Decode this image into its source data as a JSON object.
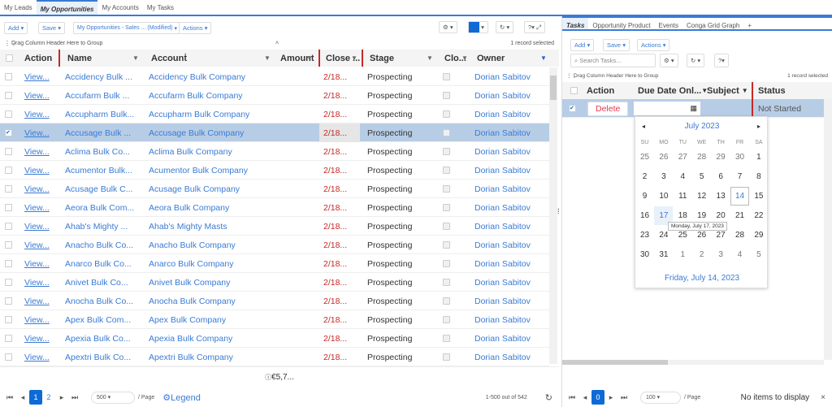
{
  "top_tabs": [
    {
      "label": "My Leads"
    },
    {
      "label": "My Opportunities",
      "active": true
    },
    {
      "label": "My Accounts"
    },
    {
      "label": "My Tasks"
    }
  ],
  "left": {
    "toolbar": {
      "add": "Add",
      "save": "Save",
      "view": "My Opportunities - Sales ... (Modified)",
      "actions": "Actions"
    },
    "group_hint": "Drag Column Header Here to Group",
    "selected_count": "1 record selected",
    "columns": [
      "Action",
      "Name",
      "Account",
      "Amount",
      "Close ...",
      "Stage",
      "Clo...",
      "Owner"
    ],
    "rows": [
      {
        "action": "View...",
        "name": "Accidency Bulk ...",
        "account": "Accidency Bulk Company",
        "close": "2/18...",
        "stage": "Prospecting",
        "owner": "Dorian Sabitov"
      },
      {
        "action": "View...",
        "name": "Accufarm Bulk ...",
        "account": "Accufarm Bulk Company",
        "close": "2/18...",
        "stage": "Prospecting",
        "owner": "Dorian Sabitov"
      },
      {
        "action": "View...",
        "name": "Accupharm Bulk...",
        "account": "Accupharm Bulk Company",
        "close": "2/18...",
        "stage": "Prospecting",
        "owner": "Dorian Sabitov"
      },
      {
        "action": "View...",
        "name": "Accusage Bulk ...",
        "account": "Accusage Bulk Company",
        "close": "2/18...",
        "stage": "Prospecting",
        "owner": "Dorian Sabitov",
        "selected": true
      },
      {
        "action": "View...",
        "name": "Aclima Bulk Co...",
        "account": "Aclima Bulk Company",
        "close": "2/18...",
        "stage": "Prospecting",
        "owner": "Dorian Sabitov"
      },
      {
        "action": "View...",
        "name": "Acumentor Bulk...",
        "account": "Acumentor Bulk Company",
        "close": "2/18...",
        "stage": "Prospecting",
        "owner": "Dorian Sabitov"
      },
      {
        "action": "View...",
        "name": "Acusage Bulk C...",
        "account": "Acusage Bulk Company",
        "close": "2/18...",
        "stage": "Prospecting",
        "owner": "Dorian Sabitov"
      },
      {
        "action": "View...",
        "name": "Aeora Bulk Com...",
        "account": "Aeora Bulk Company",
        "close": "2/18...",
        "stage": "Prospecting",
        "owner": "Dorian Sabitov"
      },
      {
        "action": "View...",
        "name": "Ahab's Mighty ...",
        "account": "Ahab's Mighty Masts",
        "close": "2/18...",
        "stage": "Prospecting",
        "owner": "Dorian Sabitov"
      },
      {
        "action": "View...",
        "name": "Anacho Bulk Co...",
        "account": "Anacho Bulk Company",
        "close": "2/18...",
        "stage": "Prospecting",
        "owner": "Dorian Sabitov"
      },
      {
        "action": "View...",
        "name": "Anarco Bulk Co...",
        "account": "Anarco Bulk Company",
        "close": "2/18...",
        "stage": "Prospecting",
        "owner": "Dorian Sabitov"
      },
      {
        "action": "View...",
        "name": "Anivet Bulk Co...",
        "account": "Anivet Bulk Company",
        "close": "2/18...",
        "stage": "Prospecting",
        "owner": "Dorian Sabitov"
      },
      {
        "action": "View...",
        "name": "Anocha Bulk Co...",
        "account": "Anocha Bulk Company",
        "close": "2/18...",
        "stage": "Prospecting",
        "owner": "Dorian Sabitov"
      },
      {
        "action": "View...",
        "name": "Apex Bulk Com...",
        "account": "Apex Bulk Company",
        "close": "2/18...",
        "stage": "Prospecting",
        "owner": "Dorian Sabitov"
      },
      {
        "action": "View...",
        "name": "Apexia Bulk Co...",
        "account": "Apexia Bulk Company",
        "close": "2/18...",
        "stage": "Prospecting",
        "owner": "Dorian Sabitov"
      },
      {
        "action": "View...",
        "name": "Apextri Bulk Co...",
        "account": "Apextri Bulk Company",
        "close": "2/18...",
        "stage": "Prospecting",
        "owner": "Dorian Sabitov"
      }
    ],
    "total": "€5,7...",
    "pager": {
      "pages": [
        "1",
        "2"
      ],
      "current": "1",
      "page_size": "500",
      "per_page": "/ Page",
      "legend": "Legend",
      "range": "1-500 out of 542"
    }
  },
  "right": {
    "tabs": [
      {
        "label": "Tasks",
        "active": true
      },
      {
        "label": "Opportunity Product"
      },
      {
        "label": "Events"
      },
      {
        "label": "Conga Grid Graph"
      },
      {
        "label": "+"
      }
    ],
    "toolbar": {
      "add": "Add",
      "save": "Save",
      "actions": "Actions",
      "search_placeholder": "Search Tasks..."
    },
    "group_hint": "Drag Column Header Here to Group",
    "selected_count": "1 record selected",
    "columns": [
      "Action",
      "Due Date Onl...",
      "Subject",
      "Status"
    ],
    "row": {
      "action": "Delete",
      "status": "Not Started"
    },
    "calendar": {
      "month": "July 2023",
      "weekdays": [
        "SU",
        "MO",
        "TU",
        "WE",
        "TH",
        "FR",
        "SA"
      ],
      "days": [
        [
          "25",
          "26",
          "27",
          "28",
          "29",
          "30",
          "1"
        ],
        [
          "2",
          "3",
          "4",
          "5",
          "6",
          "7",
          "8"
        ],
        [
          "9",
          "10",
          "11",
          "12",
          "13",
          "14",
          "15"
        ],
        [
          "16",
          "17",
          "18",
          "19",
          "20",
          "21",
          "22"
        ],
        [
          "23",
          "24",
          "25",
          "26",
          "27",
          "28",
          "29"
        ],
        [
          "30",
          "31",
          "1",
          "2",
          "3",
          "4",
          "5"
        ]
      ],
      "today": "14",
      "hover": "17",
      "tooltip": "Monday, July 17, 2023",
      "footer": "Friday, July 14, 2023"
    },
    "pager": {
      "current": "0",
      "page_size": "100",
      "per_page": "/ Page",
      "empty": "No items to display"
    }
  }
}
